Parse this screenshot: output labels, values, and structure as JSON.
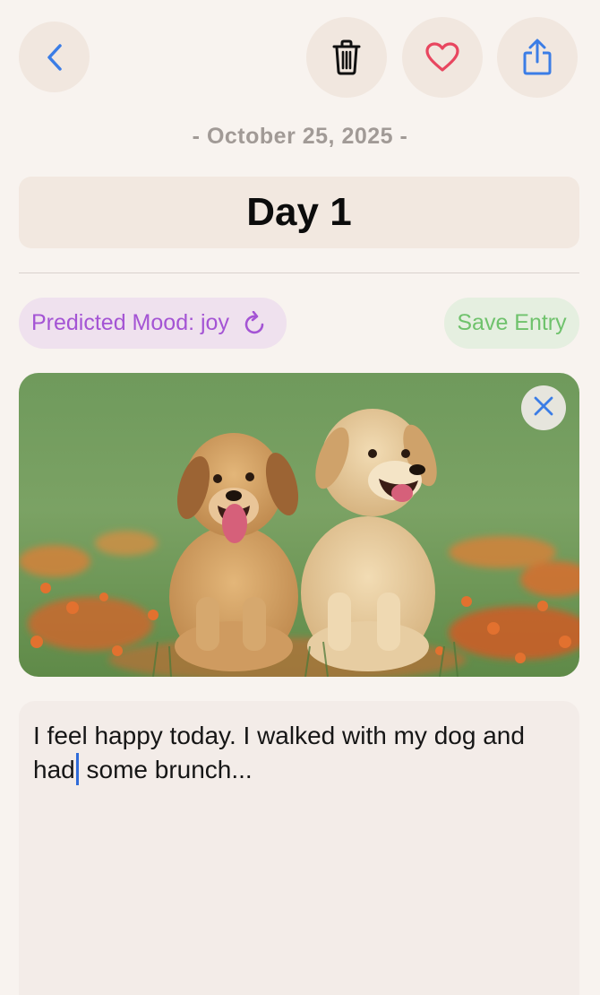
{
  "icons": {
    "back": "chevron-left-icon",
    "delete": "trash-icon",
    "favorite": "heart-icon",
    "share": "share-icon",
    "refresh": "refresh-icon",
    "remove_photo": "close-icon"
  },
  "entry": {
    "date": "- October 25, 2025 -",
    "title": "Day 1",
    "text_before_cursor": "I feel happy today. I walked with my dog and had",
    "text_after_cursor": " some brunch..."
  },
  "mood": {
    "label": "Predicted Mood: joy"
  },
  "actions": {
    "save_label": "Save Entry"
  },
  "colors": {
    "background": "#f8f3ef",
    "button_background": "#f1e7df",
    "accent_blue": "#3b7de6",
    "heart_red": "#e8465f",
    "mood_purple": "#a454d4",
    "save_green": "#6fc26c",
    "date_gray": "#a19a96"
  }
}
